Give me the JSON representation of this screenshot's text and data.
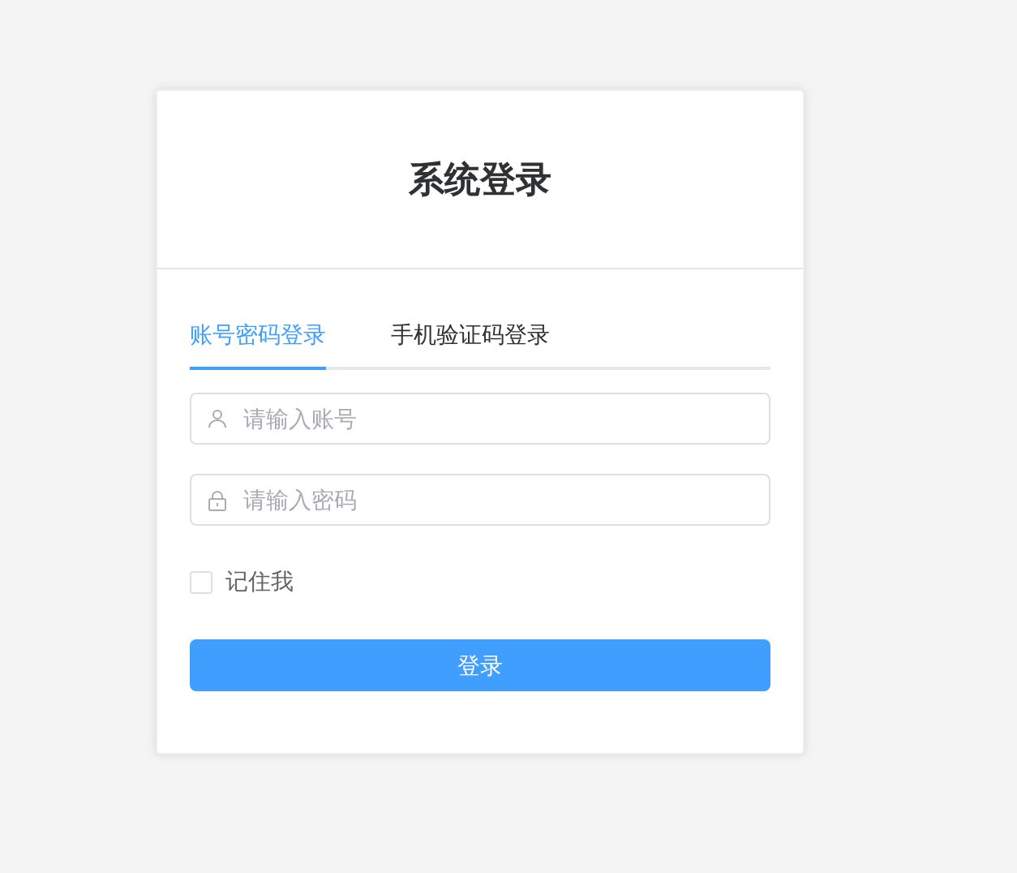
{
  "title": "系统登录",
  "tabs": [
    {
      "label": "账号密码登录",
      "selected": true
    },
    {
      "label": "手机验证码登录",
      "selected": false
    }
  ],
  "fields": [
    {
      "kind": "user",
      "placeholder": "请输入账号"
    },
    {
      "kind": "lock",
      "placeholder": "请输入密码"
    }
  ],
  "remember": {
    "label": "记住我",
    "checked": false
  },
  "submit": "登录"
}
